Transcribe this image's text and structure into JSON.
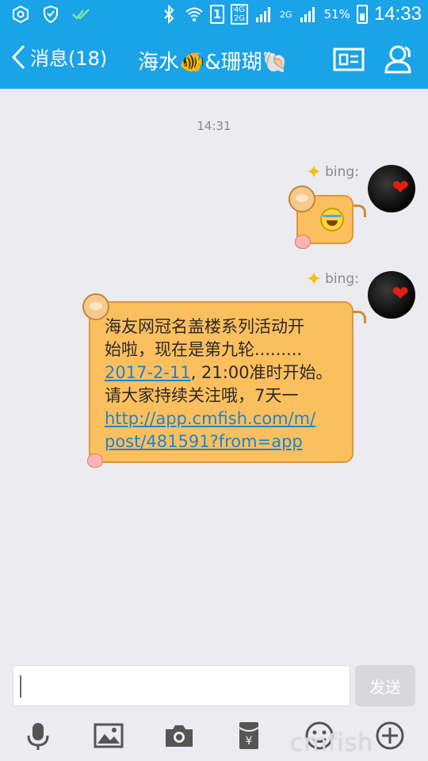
{
  "status_bar": {
    "network_top": "4G",
    "network_bottom": "2G",
    "sim": "1",
    "network2": "2G",
    "battery": "51%",
    "time": "14:33"
  },
  "header": {
    "back_label": "消息(18)",
    "title": "海水🐠&珊瑚🐚",
    "bg_color": "#1ba3e8"
  },
  "chat": {
    "timestamp": "14:31",
    "messages": [
      {
        "sender": "bing:",
        "type": "emoji",
        "emoji": "laughing-crying"
      },
      {
        "sender": "bing:",
        "type": "text",
        "lines": [
          "海友网冠名盖楼系列活动开",
          "始啦，现在是第九轮.........",
          "2017-2-11, 21:00准时开始。",
          "请大家持续关注哦，7天一",
          "http://app.cmfish.com/m/",
          "post/481591?from=app"
        ],
        "link_date": "2017-2-11",
        "line3_rest": ", 21:00准时开始。"
      }
    ]
  },
  "input_bar": {
    "placeholder": "",
    "send_label": "发送",
    "tools": [
      "microphone-icon",
      "image-icon",
      "camera-icon",
      "red-packet-icon",
      "emoji-icon",
      "plus-icon"
    ]
  },
  "watermark": "cmfish"
}
